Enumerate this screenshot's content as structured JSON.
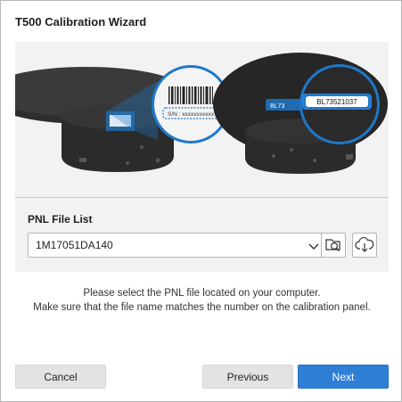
{
  "window": {
    "title": "T500 Calibration Wizard"
  },
  "illustration": {
    "serial_callout": "S/N : xxxxxxxxxxx",
    "panel_label": "BL73521037",
    "panel_label_partial": "BL73"
  },
  "pnl": {
    "label": "PNL File List",
    "selected_file": "1M17051DA140",
    "browse_icon": "folder-search-icon",
    "download_icon": "cloud-download-icon"
  },
  "instructions": {
    "line1": "Please select the PNL file located on your computer.",
    "line2": "Make sure that the file name matches the number on the calibration panel."
  },
  "footer": {
    "cancel_label": "Cancel",
    "previous_label": "Previous",
    "next_label": "Next"
  },
  "colors": {
    "accent": "#2f7fd7",
    "callout": "#1e78c8",
    "panel_bg": "#f2f2f2"
  }
}
